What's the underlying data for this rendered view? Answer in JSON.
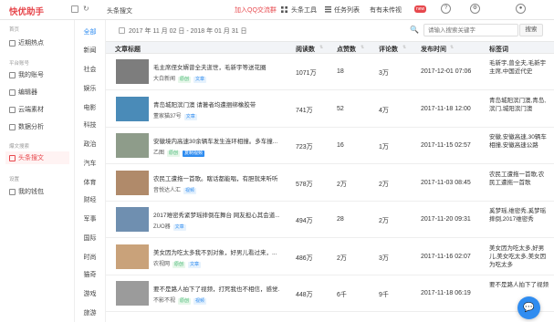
{
  "app": {
    "brand": "快优助手",
    "crumb": "头条搜文"
  },
  "topbar": {
    "join_qq": "加入QQ交流群",
    "tools": "头条工具",
    "tasks": "任务列表",
    "new_msg": "有有未传视",
    "new_badge": "new"
  },
  "sidebar": {
    "groups": [
      "首页",
      "平台账号",
      "爆文搜索",
      "设置"
    ],
    "items": [
      {
        "label": "近期热点"
      },
      {
        "label": "我的账号"
      },
      {
        "label": "编辑器"
      },
      {
        "label": "云端素材"
      },
      {
        "label": "数据分析"
      },
      {
        "label": "头条搜文"
      },
      {
        "label": "我的钱包"
      }
    ]
  },
  "categories": [
    "全部",
    "新闻",
    "社会",
    "娱乐",
    "电影",
    "科技",
    "政治",
    "汽车",
    "体育",
    "财经",
    "军事",
    "国际",
    "时尚",
    "猫奇",
    "游戏",
    "旅游"
  ],
  "filter": {
    "date_from": "2017 年 11 月 02 日",
    "date_sep": "-",
    "date_to": "2018 年 01 月 31 日",
    "search_placeholder": "请输入搜索关键字",
    "search_btn": "搜索"
  },
  "table": {
    "headers": [
      "文章标题",
      "阅读数",
      "点赞数",
      "评论数",
      "发布时间",
      "标签词"
    ],
    "rows": [
      {
        "title": "毛主席侄女婿曾全夫逝世，毛新宇等送花圈",
        "source": "大白新闻",
        "tags": [
          {
            "t": "原创",
            "c": "green"
          },
          {
            "t": "文章",
            "c": "blue"
          }
        ],
        "reads": "1071万",
        "likes": "18",
        "comments": "3万",
        "time": "2017-12-01 07:06",
        "keywords": "毛新宇,曾全夫,毛新宇主席,中国近代史",
        "thumb": "#7d7d7d"
      },
      {
        "title": "青岛城阳滨门澳 请著者均遭捆绑橡胶带",
        "source": "董家猫37号",
        "tags": [
          {
            "t": "文章",
            "c": "blue"
          }
        ],
        "reads": "741万",
        "likes": "52",
        "comments": "4万",
        "time": "2017-11-18 12:00",
        "keywords": "青岛城阳滨门澳,青岛,滨门,城阳滨门澳",
        "thumb": "#4a8bb8"
      },
      {
        "title": "安徽境内高速30余辆车发生连环相撞。多车撞...",
        "source": "乙图",
        "tags": [
          {
            "t": "原创",
            "c": "green"
          },
          {
            "t": "复制视频",
            "c": "solidblue"
          }
        ],
        "reads": "723万",
        "likes": "16",
        "comments": "1万",
        "time": "2017-11-15 02:57",
        "keywords": "安徽,安徽高速,30辆车相撞,安徽高速公路",
        "thumb": "#8e9c8a"
      },
      {
        "title": "农民工遭拖一首歌。瞎话都能唱，有胆就来听听",
        "source": "音悦达人汇",
        "tags": [
          {
            "t": "视频",
            "c": "blue"
          }
        ],
        "reads": "578万",
        "likes": "2万",
        "comments": "2万",
        "time": "2017-11-03 08:45",
        "keywords": "农民工遭拖一首歌,农民工遭拖一首歌",
        "thumb": "#b08a6a"
      },
      {
        "title": "2017难密秀紧梦瑶摔倒在舞台 网友担心其会道...",
        "source": "ZUO器",
        "tags": [
          {
            "t": "文章",
            "c": "blue"
          }
        ],
        "reads": "494万",
        "likes": "28",
        "comments": "2万",
        "time": "2017-11-20 09:31",
        "keywords": "奚梦瑶,维密秀,奚梦瑶摔倒,2017维密秀",
        "thumb": "#6f8fb0"
      },
      {
        "title": "美女因为吃太多我不到对象，好男儿看过来，...",
        "source": "农视网",
        "tags": [
          {
            "t": "原创",
            "c": "green"
          },
          {
            "t": "文章",
            "c": "blue"
          }
        ],
        "reads": "486万",
        "likes": "2万",
        "comments": "3万",
        "time": "2017-11-16 02:07",
        "keywords": "美女因为吃太多,好男儿,美女吃太多,美女因为吃太多",
        "thumb": "#c9a27a"
      },
      {
        "title": "要不是路人拍下了视频，打死我也不相信，感觉...",
        "source": "不影不视",
        "tags": [
          {
            "t": "原创",
            "c": "green"
          },
          {
            "t": "视频",
            "c": "blue"
          }
        ],
        "reads": "448万",
        "likes": "6千",
        "comments": "9千",
        "time": "2017-11-18 06:19",
        "keywords": "要不是路人拍下了视频",
        "thumb": "#9b9b9b"
      }
    ]
  },
  "chat": {
    "icon": "chat-bubble-icon"
  }
}
